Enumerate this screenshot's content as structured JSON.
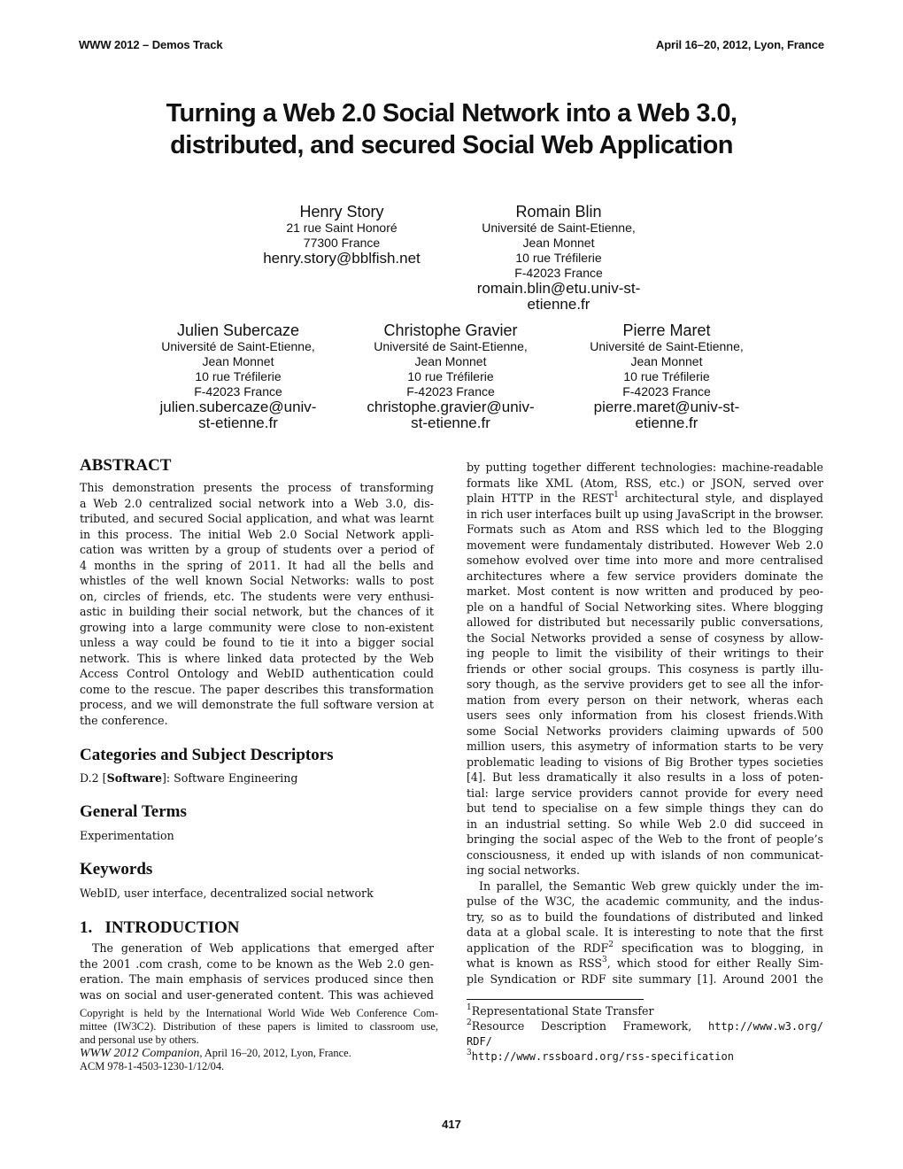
{
  "running_head": {
    "left": "WWW 2012 – Demos Track",
    "right": "April 16–20, 2012, Lyon, France"
  },
  "title": {
    "line1": "Turning a Web 2.0 Social Network into a Web 3.0,",
    "line2": "distributed, and secured Social Web Application"
  },
  "authors": [
    {
      "name": "Henry Story",
      "affiliation": [
        "21 rue Saint Honoré",
        "77300 France"
      ],
      "email": [
        "henry.story@bblfish.net"
      ]
    },
    {
      "name": "Romain Blin",
      "affiliation": [
        "Université de Saint-Etienne,",
        "Jean Monnet",
        "10 rue Tréfilerie",
        "F-42023 France"
      ],
      "email": [
        "romain.blin@etu.univ-st-",
        "etienne.fr"
      ]
    },
    {
      "name": "Julien Subercaze",
      "affiliation": [
        "Université de Saint-Etienne,",
        "Jean Monnet",
        "10 rue Tréfilerie",
        "F-42023 France"
      ],
      "email": [
        "julien.subercaze@univ-",
        "st-etienne.fr"
      ]
    },
    {
      "name": "Christophe Gravier",
      "affiliation": [
        "Université de Saint-Etienne,",
        "Jean Monnet",
        "10 rue Tréfilerie",
        "F-42023 France"
      ],
      "email": [
        "christophe.gravier@univ-",
        "st-etienne.fr"
      ]
    },
    {
      "name": "Pierre Maret",
      "affiliation": [
        "Université de Saint-Etienne,",
        "Jean Monnet",
        "10 rue Tréfilerie",
        "F-42023 France"
      ],
      "email": [
        "pierre.maret@univ-st-",
        "etienne.fr"
      ]
    }
  ],
  "abstract": {
    "heading": "ABSTRACT",
    "lines": [
      "This demonstration presents the process of transforming",
      "a Web 2.0 centralized social network into a Web 3.0, dis-",
      "tributed, and secured Social application, and what was learnt",
      "in this process. The initial Web 2.0 Social Network appli-",
      "cation was written by a group of students over a period of",
      "4 months in the spring of 2011. It had all the bells and",
      "whistles of the well known Social Networks: walls to post",
      "on, circles of friends, etc. The students were very enthusi-",
      "astic in building their social network, but the chances of it",
      "growing into a large community were close to non-existent",
      "unless a way could be found to tie it into a bigger social",
      "network. This is where linked data protected by the Web",
      "Access Control Ontology and WebID authentication could",
      "come to the rescue. The paper describes this transformation",
      "process, and we will demonstrate the full software version at",
      "the conference."
    ]
  },
  "categories": {
    "heading": "Categories and Subject Descriptors",
    "prefix": "D.2 [",
    "bold_term": "Software",
    "suffix": "]: Software Engineering"
  },
  "general_terms": {
    "heading": "General Terms",
    "text": "Experimentation"
  },
  "keywords": {
    "heading": "Keywords",
    "text": "WebID, user interface, decentralized social network"
  },
  "introduction": {
    "heading": "1.   INTRODUCTION",
    "left_lines": [
      "The generation of Web applications that emerged after",
      "the 2001 .com crash, come to be known as the Web 2.0 gen-",
      "eration. The main emphasis of services produced since then",
      "was on social and user-generated content. This was achieved"
    ],
    "right_lines": [
      "by putting together different technologies: machine-readable",
      "formats like XML (Atom, RSS, etc.) or JSON, served over",
      "plain HTTP in the REST",
      "in rich user interfaces built up using JavaScript in the browser.",
      "Formats such as Atom and RSS which led to the Blogging",
      "movement were fundamentaly distributed. However Web 2.0",
      "somehow evolved over time into more and more centralised",
      "architectures where a few service providers dominate the",
      "market. Most content is now written and produced by peo-",
      "ple on a handful of Social Networking sites. Where blogging",
      "allowed for distributed but necessarily public conversations,",
      "the Social Networks provided a sense of cosyness by allow-",
      "ing people to limit the visibility of their writings to their",
      "friends or other social groups. This cosyness is partly illu-",
      "sory though, as the servive providers get to see all the infor-",
      "mation from every person on their network, wheras each",
      "users sees only information from his closest friends.With",
      "some Social Networks providers claiming upwards of 500",
      "million users, this asymetry of information starts to be very",
      "problematic leading to visions of Big Brother types societies",
      "[4]. But less dramatically it also results in a loss of poten-",
      "tial: large service providers cannot provide for every need",
      "but tend to specialise on a few simple things they can do",
      "in an industrial setting. So while Web 2.0 did succeed in",
      "bringing the social aspec of the Web to the front of people’s",
      "consciousness, it ended up with islands of non communicat-",
      "ing social networks.",
      "In parallel, the Semantic Web grew quickly under the im-",
      "pulse of the W3C, the academic community, and the indus-",
      "try, so as to build the foundations of distributed and linked",
      "data at a global scale. It is interesting to note that the first",
      "application of the RDF",
      "what is known as RSS",
      "ple Syndication or RDF site summary [1]. Around 2001 the"
    ],
    "right_line3_sup": "1",
    "right_line3_tail": " architectural style, and displayed",
    "rdf_sup": "2",
    "rdf_tail": " specification was to blogging, in",
    "rss_sup": "3",
    "rss_tail": ", which stood for either Really Sim-"
  },
  "copyright": {
    "line1": "Copyright is held by the International World Wide Web Conference Com-",
    "line2": "mittee (IW3C2). Distribution of these papers is limited to classroom use,",
    "line3": "and personal use by others.",
    "companion_italic": "WWW 2012 Companion",
    "companion_rest": ", April 16–20, 2012, Lyon, France.",
    "acm": "ACM 978-1-4503-1230-1/12/04."
  },
  "footnotes": [
    {
      "mark": "1",
      "text": "Representational State Transfer"
    },
    {
      "mark": "2",
      "text": "Resource Description Framework, ",
      "url": "http://www.w3.org/",
      "url2": "RDF/"
    },
    {
      "mark": "3",
      "url": "http://www.rssboard.org/rss-specification"
    }
  ],
  "page_number": "417"
}
